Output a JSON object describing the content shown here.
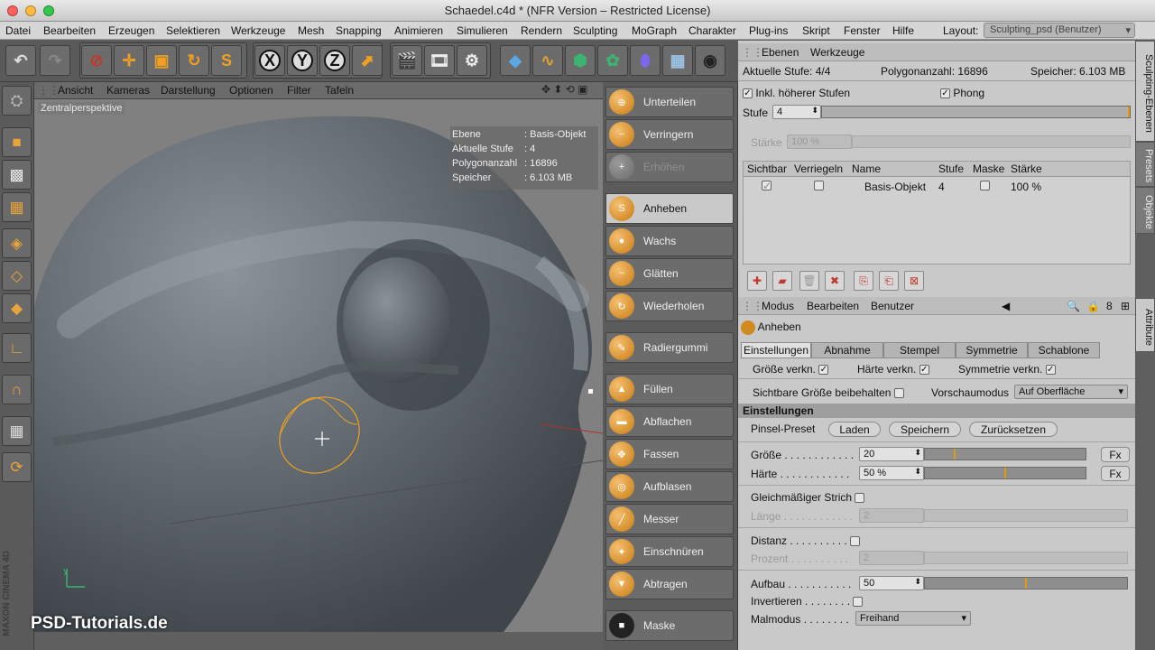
{
  "window": {
    "title": "Schaedel.c4d * (NFR Version – Restricted License)"
  },
  "menu": [
    "Datei",
    "Bearbeiten",
    "Erzeugen",
    "Selektieren",
    "Werkzeuge",
    "Mesh",
    "Snapping",
    "Animieren",
    "Simulieren",
    "Rendern",
    "Sculpting",
    "MoGraph",
    "Charakter",
    "Plug-ins",
    "Skript",
    "Fenster",
    "Hilfe"
  ],
  "layout": {
    "label": "Layout:",
    "value": "Sculpting_psd (Benutzer)"
  },
  "toolbar": {
    "x": "X",
    "y": "Y",
    "z": "Z"
  },
  "viewport": {
    "menu": [
      "Ansicht",
      "Kameras",
      "Darstellung",
      "Optionen",
      "Filter",
      "Tafeln"
    ],
    "label": "Zentralperspektive",
    "hud": [
      {
        "k": "Ebene",
        "v": ": Basis-Objekt"
      },
      {
        "k": "Aktuelle Stufe",
        "v": ": 4"
      },
      {
        "k": "Polygonanzahl",
        "v": ": 16896"
      },
      {
        "k": "Speicher",
        "v": ": 6.103 MB"
      }
    ],
    "watermark": "PSD-Tutorials.de",
    "brand": "MAXON CINEMA 4D"
  },
  "brushes": [
    {
      "label": "Unterteilen",
      "state": "normal"
    },
    {
      "label": "Verringern",
      "state": "normal"
    },
    {
      "label": "Erhöhen",
      "state": "dim"
    },
    {
      "label": "Anheben",
      "state": "selected"
    },
    {
      "label": "Wachs",
      "state": "normal"
    },
    {
      "label": "Glätten",
      "state": "normal"
    },
    {
      "label": "Wiederholen",
      "state": "normal"
    },
    {
      "label": "Radiergummi",
      "state": "normal"
    },
    {
      "label": "Füllen",
      "state": "normal"
    },
    {
      "label": "Abflachen",
      "state": "normal"
    },
    {
      "label": "Fassen",
      "state": "normal"
    },
    {
      "label": "Aufblasen",
      "state": "normal"
    },
    {
      "label": "Messer",
      "state": "normal"
    },
    {
      "label": "Einschnüren",
      "state": "normal"
    },
    {
      "label": "Abtragen",
      "state": "normal"
    },
    {
      "label": "Maske",
      "state": "normal"
    }
  ],
  "layers": {
    "tabs": [
      "Ebenen",
      "Werkzeuge"
    ],
    "current_level": "Aktuelle Stufe: 4/4",
    "polycount": "Polygonanzahl: 16896",
    "memory": "Speicher: 6.103 MB",
    "incl_higher": "Inkl. höherer Stufen",
    "phong": "Phong",
    "level_label": "Stufe",
    "level_value": "4",
    "strength_label": "Stärke",
    "strength_value": "100 %",
    "columns": [
      "Sichtbar",
      "Verriegeln",
      "Name",
      "Stufe",
      "Maske",
      "Stärke"
    ],
    "row": {
      "name": "Basis-Objekt",
      "level": "4",
      "strength": "100 %"
    }
  },
  "side_tabs": [
    "Sculpting-Ebenen",
    "Presets",
    "Objekte",
    "Attribute"
  ],
  "attributes": {
    "menu": [
      "Modus",
      "Bearbeiten",
      "Benutzer"
    ],
    "tool": "Anheben",
    "tabs": [
      "Einstellungen",
      "Abnahme",
      "Stempel",
      "Symmetrie",
      "Schablone"
    ],
    "link_size": "Größe verkn.",
    "link_hardness": "Härte verkn.",
    "link_symmetry": "Symmetrie verkn.",
    "keep_size": "Sichtbare Größe beibehalten",
    "preview_label": "Vorschaumodus",
    "preview_value": "Auf Oberfläche",
    "section": "Einstellungen",
    "preset_label": "Pinsel-Preset",
    "load": "Laden",
    "save": "Speichern",
    "reset": "Zurücksetzen",
    "size_label": "Größe . . . . . . . . . . . .",
    "size_value": "20",
    "size_frac": 0.18,
    "hardness_label": "Härte . . . . . . . . . . . .",
    "hardness_value": "50 %",
    "hardness_frac": 0.5,
    "fx": "Fx",
    "even_stroke": "Gleichmäßiger Strich",
    "length_label": "Länge . . . . . . . . . . . .",
    "length_value": "2",
    "distance_label": "Distanz . . . . . . . . . .",
    "percent_label": "Prozent . . . . . . . . . .",
    "percent_value": "2",
    "buildup_label": "Aufbau . . . . . . . . . . .",
    "buildup_value": "50",
    "buildup_frac": 0.5,
    "invert_label": "Invertieren . . . . . . . .",
    "paintmode_label": "Malmodus . . . . . . . .",
    "paintmode_value": "Freihand"
  }
}
